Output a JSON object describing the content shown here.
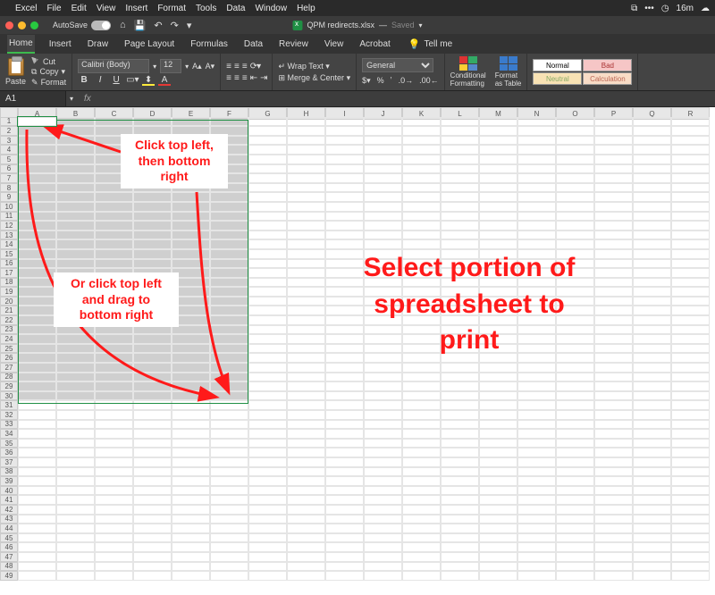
{
  "mac_menu": {
    "items": [
      "Excel",
      "File",
      "Edit",
      "View",
      "Insert",
      "Format",
      "Tools",
      "Data",
      "Window",
      "Help"
    ],
    "right": {
      "time": "16m"
    }
  },
  "title": {
    "autosave_label": "AutoSave",
    "doc_name": "QPM redirects.xlsx",
    "saved_label": "Saved"
  },
  "ribbon_tabs": [
    "Home",
    "Insert",
    "Draw",
    "Page Layout",
    "Formulas",
    "Data",
    "Review",
    "View",
    "Acrobat"
  ],
  "ribbon_active_tab": "Home",
  "tell_me": "Tell me",
  "clipboard": {
    "paste": "Paste",
    "cut": "Cut",
    "copy": "Copy",
    "format": "Format"
  },
  "font": {
    "name": "Calibri (Body)",
    "size": "12"
  },
  "alignment": {
    "wrap": "Wrap Text",
    "merge": "Merge & Center"
  },
  "number": {
    "format": "General"
  },
  "styles_group": {
    "cf": "Conditional\nFormatting",
    "ft": "Format\nas Table",
    "normal": "Normal",
    "bad": "Bad",
    "neutral": "Neutral",
    "calculation": "Calculation"
  },
  "namebox": "A1",
  "columns": [
    "A",
    "B",
    "C",
    "D",
    "E",
    "F",
    "G",
    "H",
    "I",
    "J",
    "K",
    "L",
    "M",
    "N",
    "O",
    "P",
    "Q",
    "R"
  ],
  "row_count": 49,
  "selection": {
    "from": "A1",
    "to": "F30"
  },
  "annotations": {
    "top": "Click top left, then bottom right",
    "mid": "Or click top left and drag to bottom right",
    "big": "Select portion of spreadsheet to print"
  }
}
